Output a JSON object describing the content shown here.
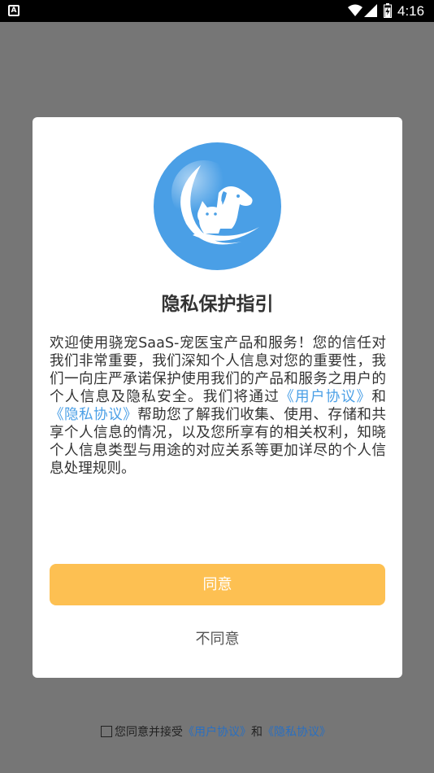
{
  "status_bar": {
    "app_icon_letter": "A",
    "time": "4:16",
    "battery_level": 0.8
  },
  "dialog": {
    "title": "隐私保护指引",
    "body": {
      "part1": "欢迎使用骁宠SaaS-宠医宝产品和服务！您的信任对我们非常重要，我们深知个人信息对您的重要性，我们一向庄严承诺保护使用我们的产品和服务之用户的个人信息及隐私安全。我们将通过",
      "user_agreement_link": "《用户协议》",
      "conjunction": "和",
      "privacy_agreement_link": "《隐私协议》",
      "part2": "帮助您了解我们收集、使用、存储和共享个人信息的情况，以及您所享有的相关权利，知晓个人信息类型与用途的对应关系等更加详尽的个人信息处理规则。"
    },
    "agree_label": "同意",
    "disagree_label": "不同意"
  },
  "consent": {
    "text": "您同意并接受",
    "user_agreement_link": "《用户协议》",
    "conjunction": "和",
    "privacy_agreement_link": "《隐私协议》",
    "checked": false
  },
  "colors": {
    "accent_blue": "#4a9fe6",
    "agree_yellow": "#fdc052",
    "overlay_gray": "#767676"
  },
  "icons": {
    "logo": "pet-cat-dog-moon-logo",
    "wifi": "wifi-icon",
    "signal": "signal-icon",
    "battery": "battery-icon"
  }
}
